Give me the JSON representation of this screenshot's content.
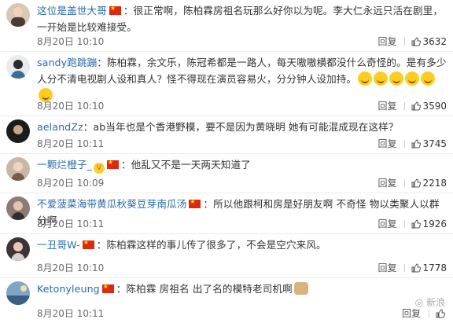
{
  "comments": [
    {
      "user": "这位是盖世大哥",
      "text": "：很正常啊，陈柏霖房祖名玩那么好你以为呢。李大仁永远只活在剧里，一开始是比较难接受。",
      "time": "8月20日 10:10",
      "reply": "回复",
      "likes": "3632"
    },
    {
      "user": "sandy跑跳蹦",
      "text": "：陈柏霖，余文乐，陈冠希都是一路人，每天嗷嗷横都没什么奇怪的。是有多少人分不清电视剧人设和真人？怪不得现在演员容易火，分分钟人设加持。",
      "time": "8月20日 10:10",
      "reply": "回复",
      "likes": "3590"
    },
    {
      "user": "aelandZz",
      "text": "：ab当年也是个香港野模，要不是因为黄晓明 她有可能混成现在这样？",
      "time": "8月20日 10:11",
      "reply": "回复",
      "likes": "3745"
    },
    {
      "user": "一颗烂橙子_",
      "text": "：他乱又不是一天两天知道了",
      "time": "8月20日 10:09",
      "reply": "回复",
      "likes": "2218"
    },
    {
      "user": "不爱菠菜海带黄瓜秋葵豆芽南瓜汤",
      "text": "：所以他跟柯和房是好朋友啊 不奇怪 物以类聚人以群分啊",
      "time": "8月20日 10:11",
      "reply": "回复",
      "likes": "1926"
    },
    {
      "user": "一丑哥W-",
      "text": "：陈柏霖这样的事儿传了很多了，不会是空穴来风。",
      "time": "8月20日 10:10",
      "reply": "回复",
      "likes": "1778"
    },
    {
      "user": "Ketonyleung",
      "text": "：陈柏霖 房祖名 出了名的模特老司机啊",
      "time": "8月20日 10:11",
      "reply": "回复",
      "likes": ""
    }
  ],
  "badge_text": "V",
  "watermark": "新浪",
  "colors": {
    "username": "#2a6ba8",
    "flag": "#de2910"
  }
}
